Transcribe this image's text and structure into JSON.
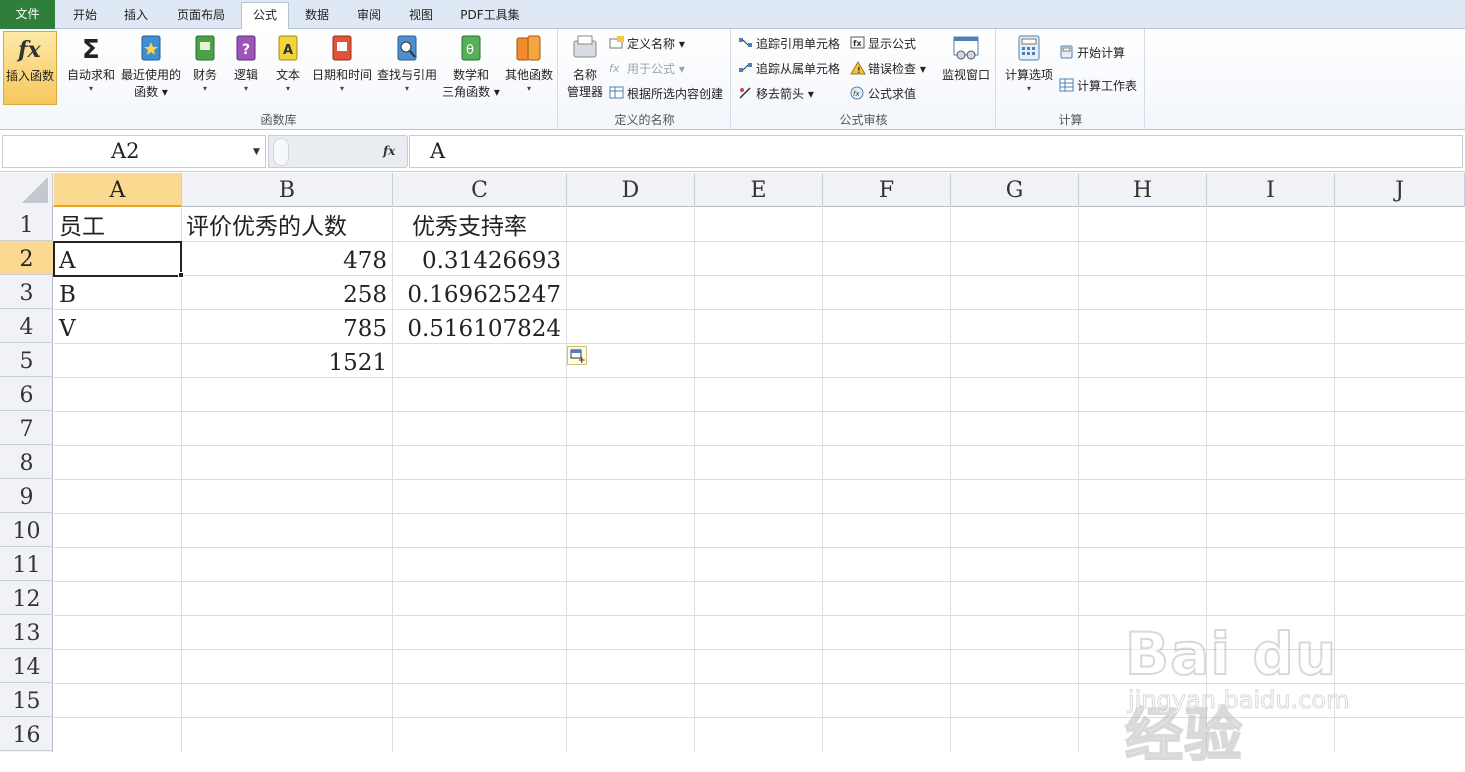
{
  "tabs": [
    {
      "label": "文件",
      "active": false,
      "file": true
    },
    {
      "label": "开始",
      "active": false
    },
    {
      "label": "插入",
      "active": false
    },
    {
      "label": "页面布局",
      "active": false
    },
    {
      "label": "公式",
      "active": true
    },
    {
      "label": "数据",
      "active": false
    },
    {
      "label": "审阅",
      "active": false
    },
    {
      "label": "视图",
      "active": false
    },
    {
      "label": "PDF工具集",
      "active": false
    }
  ],
  "ribbon": {
    "function_library": {
      "label": "函数库",
      "insert_function": "插入函数",
      "autosum": "自动求和",
      "recent_line1": "最近使用的",
      "recent_line2": "函数",
      "financial": "财务",
      "logical": "逻辑",
      "text": "文本",
      "datetime": "日期和时间",
      "lookup": "查找与引用",
      "math_line1": "数学和",
      "math_line2": "三角函数",
      "more": "其他函数"
    },
    "defined_names": {
      "label": "定义的名称",
      "name_manager_line1": "名称",
      "name_manager_line2": "管理器",
      "define_name": "定义名称",
      "use_in_formula": "用于公式",
      "create_from_selection": "根据所选内容创建"
    },
    "formula_auditing": {
      "label": "公式审核",
      "trace_precedents": "追踪引用单元格",
      "trace_dependents": "追踪从属单元格",
      "remove_arrows": "移去箭头",
      "show_formulas": "显示公式",
      "error_checking": "错误检查",
      "evaluate_formula": "公式求值",
      "watch_window": "监视窗口"
    },
    "calculation": {
      "label": "计算",
      "calc_options": "计算选项",
      "calc_now": "开始计算",
      "calc_sheet": "计算工作表"
    }
  },
  "formula_bar": {
    "name_box": "A2",
    "fx": "fx",
    "content": "A"
  },
  "columns": [
    "A",
    "B",
    "C",
    "D",
    "E",
    "F",
    "G",
    "H",
    "I",
    "J"
  ],
  "rows": [
    "1",
    "2",
    "3",
    "4",
    "5",
    "6",
    "7",
    "8",
    "9",
    "10",
    "11",
    "12",
    "13",
    "14",
    "15",
    "16"
  ],
  "selected": {
    "column": "A",
    "row": "2"
  },
  "cells": {
    "A1": "员工",
    "B1": "评价优秀的人数",
    "C1": "优秀支持率",
    "A2": "A",
    "B2": "478",
    "C2": "0.31426693",
    "A3": "B",
    "B3": "258",
    "C3": "0.169625247",
    "A4": "V",
    "B4": "785",
    "C4": "0.516107824",
    "B5": "1521"
  },
  "watermark": {
    "brand": "Bai du 经验",
    "url": "jingyan.baidu.com"
  },
  "colors": {
    "file_tab": "#2f7e39",
    "selection_header": "#fcd991",
    "accent": "#e8a523"
  }
}
